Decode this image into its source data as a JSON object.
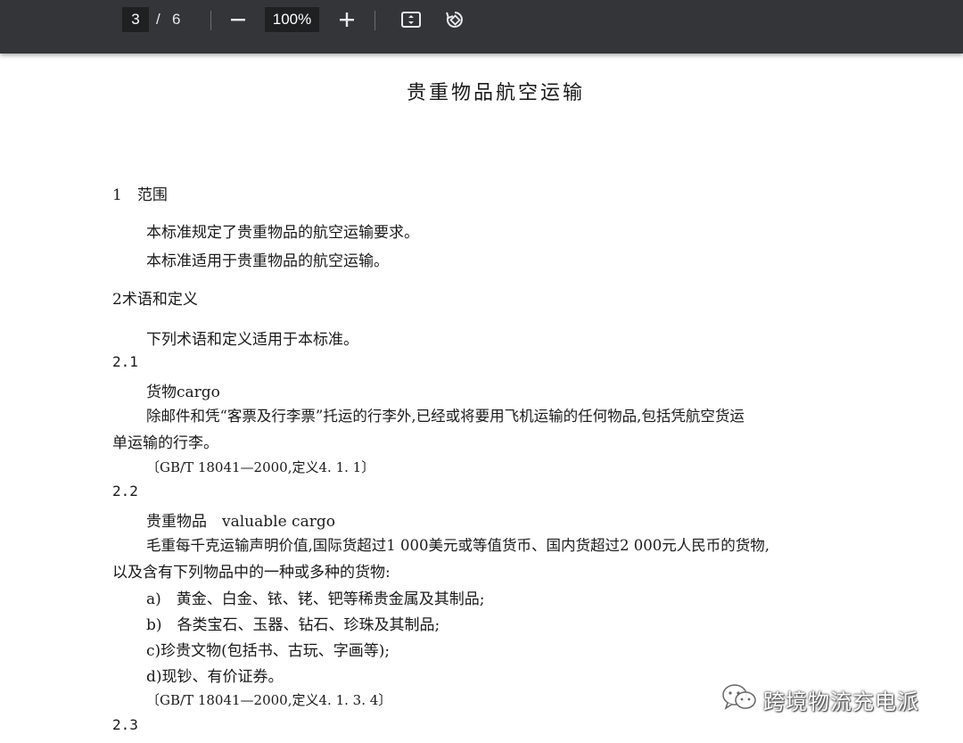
{
  "toolbar": {
    "current_page": "3",
    "separator": "/",
    "total_pages": "6",
    "zoom": "100%",
    "icons": [
      "zoom-out-icon",
      "zoom-in-icon",
      "fit-page-icon",
      "rotate-icon"
    ]
  },
  "document": {
    "title": "贵重物品航空运输",
    "s1_heading": "1　范围",
    "s1_p1": "本标准规定了贵重物品的航空运输要求。",
    "s1_p2": "本标准适用于贵重物品的航空运输。",
    "s2_heading": "2术语和定义",
    "s2_p1": "下列术语和定义适用于本标准。",
    "s21_num": "2.1",
    "s21_term": "货物cargo",
    "s21_def_line1": "除邮件和凭“客票及行李票”托运的行李外,已经或将要用飞机运输的任何物品,包括凭航空货运",
    "s21_def_line2": "单运输的行李。",
    "s21_ref": "〔GB/T 18041—2000,定义4. 1. 1〕",
    "s22_num": "2.2",
    "s22_term": "贵重物品　valuable cargo",
    "s22_def_line1": "毛重每千克运输声明价值,国际货超过1 000美元或等值货币、国内货超过2 000元人民币的货物,",
    "s22_def_line2": "以及含有下列物品中的一种或多种的货物:",
    "s22_item_a": "a)　黄金、白金、铱、铑、钯等稀贵金属及其制品;",
    "s22_item_b": "b)　各类宝石、玉器、钻石、珍珠及其制品;",
    "s22_item_c": "c)珍贵文物(包括书、古玩、字画等);",
    "s22_item_d": "d)现钞、有价证券。",
    "s22_ref": "〔GB/T 18041—2000,定义4. 1. 3. 4〕",
    "s23_num": "2.3"
  },
  "watermark": {
    "text": "跨境物流充电派",
    "icon": "wechat-icon"
  }
}
